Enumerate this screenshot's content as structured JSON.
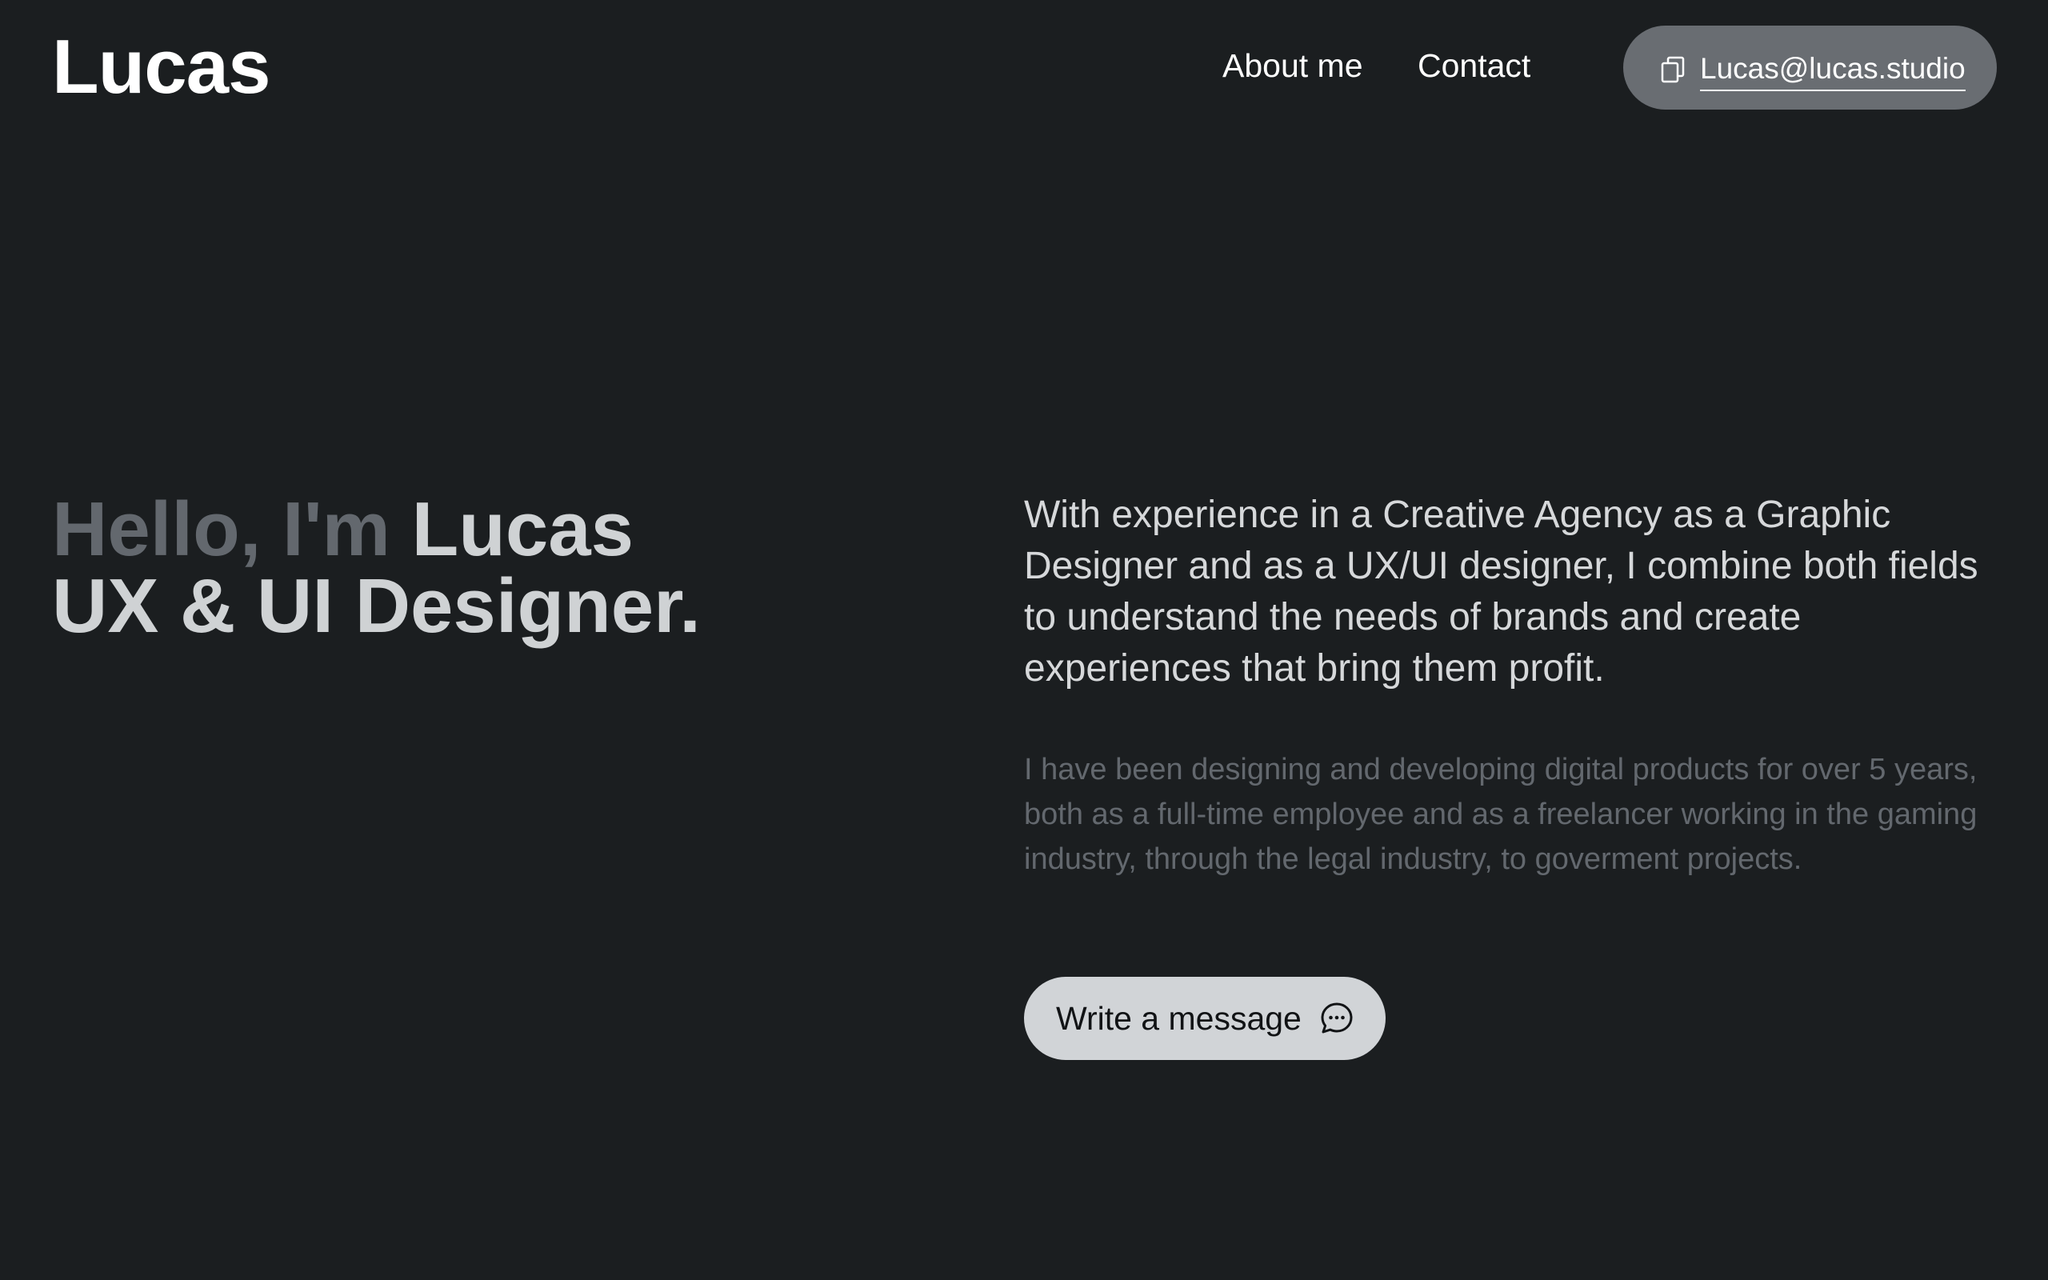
{
  "header": {
    "logo": "Lucas",
    "nav": {
      "about": "About me",
      "contact": "Contact"
    },
    "email_button": {
      "icon": "copy-icon",
      "label": "Lucas@lucas.studio"
    }
  },
  "hero": {
    "greeting_prefix": "Hello, I'm",
    "name": "Lucas",
    "role": "UX & UI Designer.",
    "lead": "With experience in a Creative Agency as a Graphic Designer and as a UX/UI designer, I combine both fields to understand the needs of brands and create experiences that bring them profit.",
    "sub": "I have been designing and developing digital products for over 5 years, both as a full-time employee and as a freelancer working in the gaming industry, through the legal industry, to goverment projects.",
    "cta": {
      "label": "Write a message",
      "icon": "chat-bubble-icon"
    }
  },
  "colors": {
    "background": "#1b1e20",
    "muted_text": "#63686e",
    "light_text": "#cfd2d4",
    "pill_dark": "#696d72",
    "pill_light": "#d1d4d7"
  }
}
